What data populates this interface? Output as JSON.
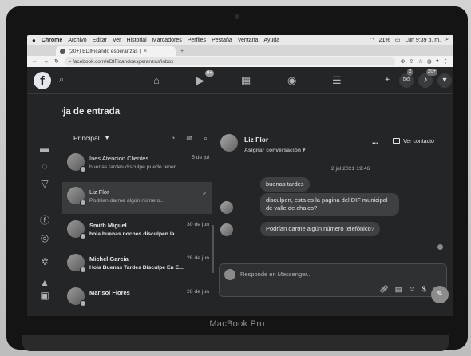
{
  "device": {
    "label": "MacBook Pro"
  },
  "menubar": {
    "apple": "",
    "items": [
      "Chrome",
      "Archivo",
      "Editar",
      "Ver",
      "Historial",
      "Marcadores",
      "Perfiles",
      "Pestaña",
      "Ventana",
      "Ayuda"
    ],
    "battery": "21%",
    "clock": "Lun 9:39 p. m."
  },
  "browser": {
    "tab_title": "(20+) EDIFicando esperanzas |",
    "url": "facebook.com/eDIFicandoesperanzas/inbox"
  },
  "facebook": {
    "logo": "f",
    "badges": {
      "watch": "9+",
      "messenger": "2",
      "notifications": "20+"
    }
  },
  "inbox": {
    "title": "Bandeja de entrada",
    "filter": "Principal",
    "conversations": [
      {
        "name": "Ines Atencion Clientes",
        "message": "buenas tardes disculpe puedo tener...",
        "date": "5 de jul"
      },
      {
        "name": "Liz Flor",
        "message": "Podrían darme algún número...",
        "date": ""
      },
      {
        "name": "Smith Miguel",
        "message": "hola buenas noches disculpen la...",
        "date": "30 de jun"
      },
      {
        "name": "Michel Garcia",
        "message": "Hola Buenas Tardes Disculpe En E...",
        "date": "28 de jun"
      },
      {
        "name": "Marisol Flores",
        "message": "",
        "date": "28 de jun"
      }
    ]
  },
  "chat": {
    "name": "Liz Flor",
    "assign": "Asignar conversación",
    "more": "...",
    "view_contact": "Ver contacto",
    "timestamp": "2 jul 2021 19:46",
    "messages": [
      "buenas tardes",
      "disculpen, esta es la pagina del DIF municipal de valle de chalco?",
      "Podrían darme algún número telefónico?"
    ],
    "composer_placeholder": "Responde en Messenger..."
  }
}
